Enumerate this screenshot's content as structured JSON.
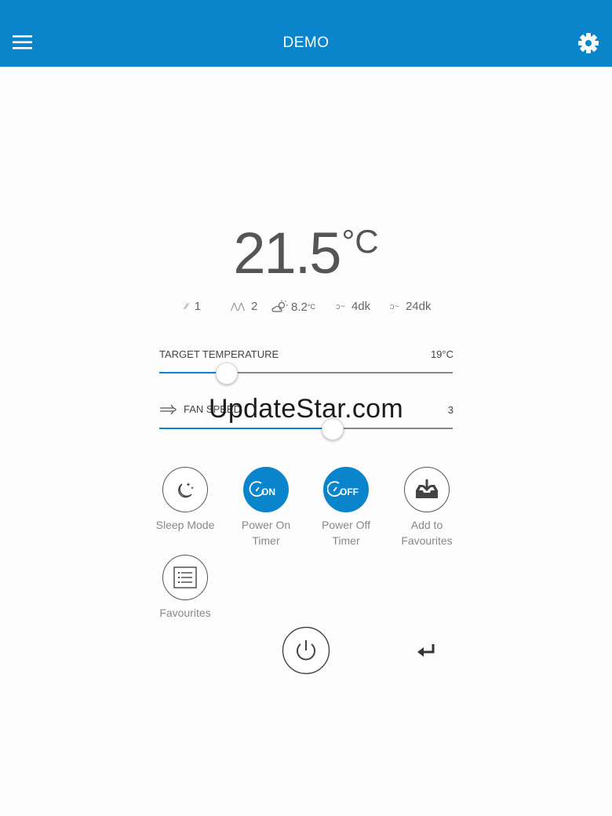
{
  "header": {
    "title": "DEMO",
    "menu_icon": "hamburger-menu-icon",
    "settings_icon": "gear-icon"
  },
  "current": {
    "temperature": "21.5",
    "unit": "°C"
  },
  "info": {
    "item1": "1",
    "item2": "2",
    "outdoor_temp": "8.2",
    "outdoor_unit": "°C",
    "timer1": "4dk",
    "timer2": "24dk"
  },
  "target_temperature": {
    "label": "TARGET TEMPERATURE",
    "value": "19°C",
    "level": 0.23
  },
  "fan_speed": {
    "label": "FAN SPEED",
    "value": "3",
    "level": 0.59
  },
  "actions": {
    "sleep_mode": "Sleep Mode",
    "power_on_timer": "Power On\nTimer",
    "power_on_badge": "ON",
    "power_off_timer": "Power Off\nTimer",
    "power_off_badge": "OFF",
    "add_to_favourites": "Add to\nFavourites",
    "favourites": "Favourites"
  },
  "watermark": "UpdateStar.com",
  "colors": {
    "accent": "#0a85cc",
    "background": "#fdfdfd"
  }
}
